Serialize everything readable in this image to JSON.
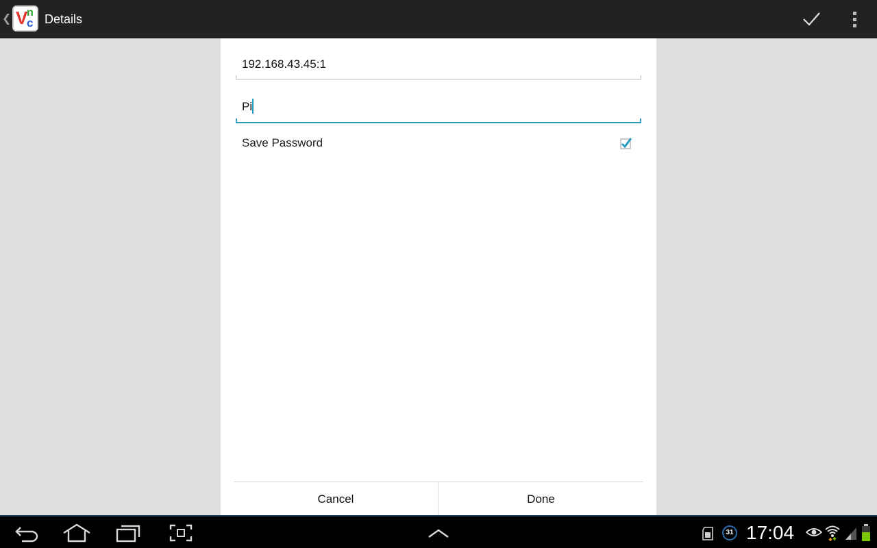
{
  "actionbar": {
    "title": "Details",
    "up_icon": "chevron-left-icon",
    "app_icon": "vnc-app-icon",
    "actions": [
      "check-icon",
      "overflow-menu-icon"
    ]
  },
  "form": {
    "host_value": "192.168.43.45:1",
    "password_value": "Pi",
    "save_password_label": "Save Password",
    "save_password_checked": true,
    "accent": "#2a9cbd"
  },
  "buttons": {
    "cancel": "Cancel",
    "done": "Done"
  },
  "system_bar": {
    "time": "17:04",
    "calendar_badge": "31",
    "nav_icons": [
      "back-icon",
      "home-icon",
      "recent-apps-icon",
      "screenshot-icon",
      "expand-up-icon"
    ],
    "status_icons": [
      "sd-card-icon",
      "calendar-notification-icon",
      "eye-icon",
      "wifi-icon",
      "signal-icon",
      "battery-icon"
    ],
    "battery_color": "#7cc700"
  }
}
